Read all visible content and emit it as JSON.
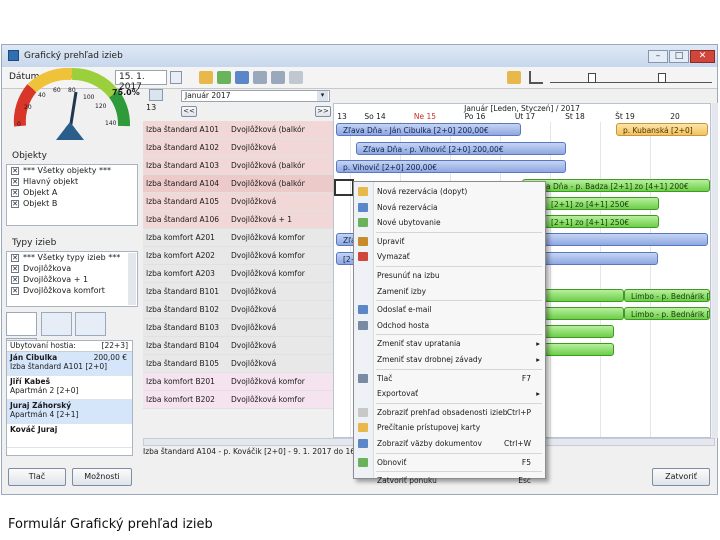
{
  "window": {
    "title": "Grafický prehľad izieb"
  },
  "toolbar": {
    "date_label": "Dátum spracovania:",
    "date_value": "15. 1. 2017"
  },
  "gauge": {
    "percent": "75.0%",
    "ticks": [
      "0",
      "20",
      "40",
      "60",
      "80",
      "100",
      "120",
      "140"
    ]
  },
  "objekty": {
    "header": "Objekty",
    "items": [
      "*** Všetky objekty ***",
      "Hlavný objekt",
      "Objekt A",
      "Objekt B"
    ]
  },
  "typy": {
    "header": "Typy izieb",
    "items": [
      "*** Všetky typy izieb ***",
      "Dvojlôžkova",
      "Dvojlôžkova + 1",
      "Dvojlôžkova komfort"
    ]
  },
  "guests": {
    "header": "Ubytovaní hostia:",
    "count": "[22+3]",
    "items": [
      {
        "name": "Ján Cibulka",
        "price": "200,00 €",
        "room": "Izba štandard A101 [2+0]"
      },
      {
        "name": "Jiří Kabeš",
        "price": "",
        "room": "Apartmán 2 [2+0]"
      },
      {
        "name": "Juraj Záhorský",
        "price": "",
        "room": "Apartmán 4 [2+1]"
      },
      {
        "name": "Kováč Juraj",
        "price": "",
        "room": ""
      }
    ]
  },
  "nav": {
    "week": "13",
    "month": "Január 2017",
    "prev": "<<",
    "next": ">>"
  },
  "rooms": [
    {
      "name": "Izba štandard A101",
      "type": "Dvojlôžková (balkón)",
      "color": "#f2d7d7"
    },
    {
      "name": "Izba štandard A102",
      "type": "Dvojlôžková",
      "color": "#f2d7d7"
    },
    {
      "name": "Izba štandard A103",
      "type": "Dvojlôžková (balkón)",
      "color": "#f2d7d7"
    },
    {
      "name": "Izba štandard A104",
      "type": "Dvojlôžková (balkón)",
      "color": "#eccaca"
    },
    {
      "name": "Izba štandard A105",
      "type": "Dvojlôžková",
      "color": "#f2d7d7"
    },
    {
      "name": "Izba štandard A106",
      "type": "Dvojlôžková + 1",
      "color": "#f2d7d7"
    },
    {
      "name": "Izba komfort A201",
      "type": "Dvojlôžková komfort",
      "color": "#e8e8e8"
    },
    {
      "name": "Izba komfort A202",
      "type": "Dvojlôžková komfort",
      "color": "#e8e8e8"
    },
    {
      "name": "Izba komfort A203",
      "type": "Dvojlôžková komfort",
      "color": "#e8e8e8"
    },
    {
      "name": "Izba štandard B101",
      "type": "Dvojlôžková",
      "color": "#e8e8e8"
    },
    {
      "name": "Izba štandard B102",
      "type": "Dvojlôžková",
      "color": "#e8e8e8"
    },
    {
      "name": "Izba štandard B103",
      "type": "Dvojlôžková",
      "color": "#e8e8e8"
    },
    {
      "name": "Izba štandard B104",
      "type": "Dvojlôžková",
      "color": "#e8e8e8"
    },
    {
      "name": "Izba štandard B105",
      "type": "Dvojlôžková",
      "color": "#e8e8e8"
    },
    {
      "name": "Izba komfort B201",
      "type": "Dvojlôžková komfort",
      "color": "#f5e3f0"
    },
    {
      "name": "Izba komfort B202",
      "type": "Dvojlôžková komfort",
      "color": "#f5e3f0"
    }
  ],
  "calendar": {
    "header": "Január [Leden, Styczeń] / 2017",
    "days": [
      "13",
      "So 14",
      "Ne 15",
      "Po 16",
      "Ut 17",
      "St 18",
      "Št 19",
      "20"
    ]
  },
  "bars": [
    {
      "text": "Zľava Dňa - Ján Cibulka [2+0] 200,00€",
      "kind": "blue"
    },
    {
      "text": "Zľava Dňa - p. Vihovič [2+0] 200,00€",
      "kind": "blue"
    },
    {
      "text": "p. Vihovič [2+0] 200,00€",
      "kind": "blue"
    },
    {
      "text": "p. Kubanská [2+0]",
      "kind": "orange"
    },
    {
      "text": "Zľava Dňa - p. Badza [2+1] zo [4+1] 200€",
      "kind": "green"
    },
    {
      "text": "[2+1] zo [4+1] 250€",
      "kind": "green"
    },
    {
      "text": "[2+1] zo [4+1] 250€",
      "kind": "green"
    },
    {
      "text": "Zľava Dňa - p. Badza [2+1] zo [4+1] 200€",
      "kind": "blue"
    },
    {
      "text": "[2+0]",
      "kind": "blue"
    },
    {
      "text": "Limbo - p. Bednárik [2+0]",
      "kind": "green"
    },
    {
      "text": "Limbo - p. Bednárik [2+0]",
      "kind": "green"
    }
  ],
  "context_menu": [
    {
      "label": "Nová rezervácia (dopyt)",
      "key": "",
      "arrow": ""
    },
    {
      "label": "Nová rezervácia",
      "key": "",
      "arrow": ""
    },
    {
      "label": "Nové ubytovanie",
      "key": "",
      "arrow": ""
    },
    {
      "label": "Upraviť",
      "key": "",
      "arrow": ""
    },
    {
      "label": "Vymazať",
      "key": "",
      "arrow": ""
    },
    {
      "label": "Presunúť na izbu",
      "key": "",
      "arrow": ""
    },
    {
      "label": "Zameniť izby",
      "key": "",
      "arrow": ""
    },
    {
      "label": "Odoslať e-mail",
      "key": "",
      "arrow": ""
    },
    {
      "label": "Odchod hosta",
      "key": "",
      "arrow": ""
    },
    {
      "label": "Zmeniť stav upratania",
      "key": "",
      "arrow": "▸"
    },
    {
      "label": "Zmeniť stav drobnej závady",
      "key": "",
      "arrow": "▸"
    },
    {
      "label": "Tlač",
      "key": "F7",
      "arrow": ""
    },
    {
      "label": "Exportovať",
      "key": "",
      "arrow": "▸"
    },
    {
      "label": "Zobraziť prehľad obsadenosti izieb",
      "key": "Ctrl+P",
      "arrow": ""
    },
    {
      "label": "Prečítanie prístupovej karty",
      "key": "",
      "arrow": ""
    },
    {
      "label": "Zobraziť väzby dokumentov",
      "key": "Ctrl+W",
      "arrow": ""
    },
    {
      "label": "Obnoviť",
      "key": "F5",
      "arrow": ""
    },
    {
      "label": "Zatvoriť ponuku",
      "key": "Esc",
      "arrow": ""
    }
  ],
  "status": {
    "text": "Izba štandard A104 - p. Kováčik [2+0] - 9. 1. 2017 do 16. 1"
  },
  "buttons": {
    "print": "Tlač",
    "options": "Možnosti",
    "close": "Zatvoriť"
  },
  "caption": "Formulár Grafický prehľad izieb"
}
